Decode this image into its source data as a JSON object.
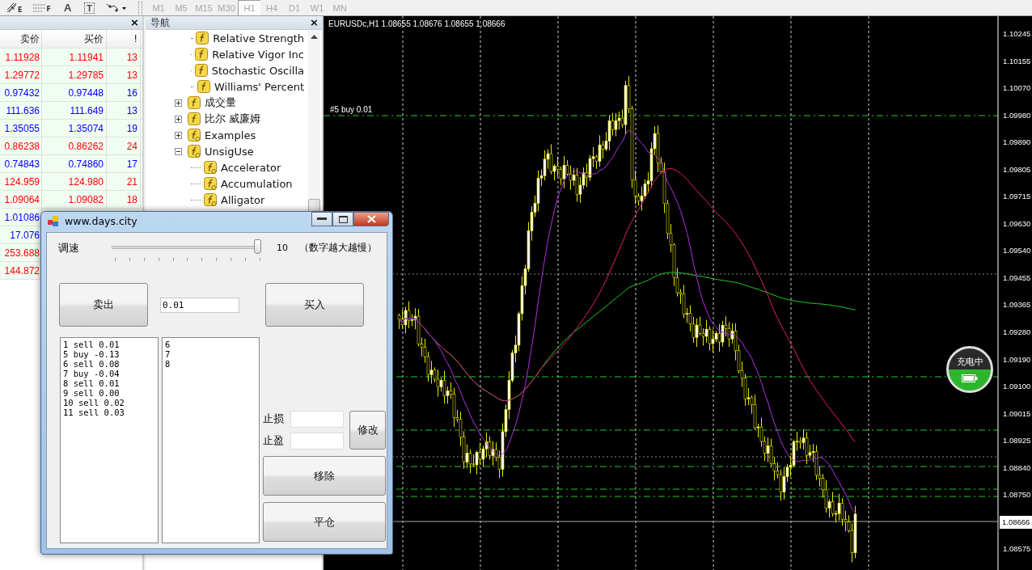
{
  "toolbar": {
    "tools": [
      {
        "kind": "grid",
        "label": "E"
      },
      {
        "kind": "lines",
        "label": "F"
      },
      {
        "kind": "text",
        "label": "A"
      },
      {
        "kind": "textbox",
        "label": "T"
      },
      {
        "kind": "arrows"
      }
    ],
    "timeframes": [
      {
        "label": "M1",
        "selected": false
      },
      {
        "label": "M5",
        "selected": false
      },
      {
        "label": "M15",
        "selected": false
      },
      {
        "label": "M30",
        "selected": false
      },
      {
        "label": "H1",
        "selected": true
      },
      {
        "label": "H4",
        "selected": false
      },
      {
        "label": "D1",
        "selected": false
      },
      {
        "label": "W1",
        "selected": false
      },
      {
        "label": "MN",
        "selected": false
      }
    ]
  },
  "market_watch": {
    "close": "×",
    "columns": [
      "卖价",
      "买价",
      "!"
    ],
    "rows": [
      {
        "bid": "1.11928",
        "ask": "1.11941",
        "spread": "13",
        "color": "#ff0000"
      },
      {
        "bid": "1.29772",
        "ask": "1.29785",
        "spread": "13",
        "color": "#ff0000"
      },
      {
        "bid": "0.97432",
        "ask": "0.97448",
        "spread": "16",
        "color": "#0000ff"
      },
      {
        "bid": "111.636",
        "ask": "111.649",
        "spread": "13",
        "color": "#0000ff"
      },
      {
        "bid": "1.35055",
        "ask": "1.35074",
        "spread": "19",
        "color": "#0000ff"
      },
      {
        "bid": "0.86238",
        "ask": "0.86262",
        "spread": "24",
        "color": "#ff0000"
      },
      {
        "bid": "0.74843",
        "ask": "0.74860",
        "spread": "17",
        "color": "#0000ff"
      },
      {
        "bid": "124.959",
        "ask": "124.980",
        "spread": "21",
        "color": "#ff0000"
      },
      {
        "bid": "1.09064",
        "ask": "1.09082",
        "spread": "18",
        "color": "#ff0000"
      },
      {
        "bid": "1.01086",
        "color": "#0000ff"
      },
      {
        "bid": "17.076",
        "color": "#0000ff"
      },
      {
        "bid": "253.688",
        "color": "#ff0000"
      },
      {
        "bid": "144.872",
        "color": "#ff0000"
      }
    ]
  },
  "navigator": {
    "title": "导航",
    "close": "×",
    "items": [
      {
        "kind": "continued",
        "children": [
          {
            "label": "Relative Strength",
            "kind": "indicator"
          },
          {
            "label": "Relative Vigor Inc",
            "kind": "indicator"
          },
          {
            "label": "Stochastic Oscilla",
            "kind": "indicator"
          },
          {
            "label": "Williams' Percent",
            "kind": "indicator"
          }
        ]
      },
      {
        "label": "成交量",
        "kind": "indicator",
        "expanded": false
      },
      {
        "label": "比尔 威廉姆",
        "kind": "indicator",
        "expanded": false
      },
      {
        "label": "Examples",
        "kind": "custom",
        "expanded": false
      },
      {
        "label": "UnsigUse",
        "kind": "custom",
        "expanded": true,
        "children": [
          {
            "label": "Accelerator",
            "kind": "custom"
          },
          {
            "label": "Accumulation",
            "kind": "custom"
          },
          {
            "label": "Alligator",
            "kind": "custom"
          }
        ]
      }
    ]
  },
  "chart": {
    "header": "EURUSDc,H1  1.08655 1.08676 1.08655 1.08666",
    "order_label": "#5 buy 0.01",
    "price_labels": [
      {
        "label": "1.10245",
        "current": false
      },
      {
        "label": "1.10155",
        "current": false
      },
      {
        "label": "1.10070",
        "current": false
      },
      {
        "label": "1.09980",
        "current": false
      },
      {
        "label": "1.09890",
        "current": false
      },
      {
        "label": "1.09805",
        "current": false
      },
      {
        "label": "1.09715",
        "current": false
      },
      {
        "label": "1.09630",
        "current": false
      },
      {
        "label": "1.09540",
        "current": false
      },
      {
        "label": "1.09455",
        "current": false
      },
      {
        "label": "1.09365",
        "current": false
      },
      {
        "label": "1.09280",
        "current": false
      },
      {
        "label": "1.09190",
        "current": false
      },
      {
        "label": "1.09100",
        "current": false
      },
      {
        "label": "1.09015",
        "current": false
      },
      {
        "label": "1.08925",
        "current": false
      },
      {
        "label": "1.08840",
        "current": false
      },
      {
        "label": "1.08750",
        "current": false
      },
      {
        "label": "1.08666",
        "current": true
      },
      {
        "label": "1.08575",
        "current": false
      }
    ]
  },
  "charging": {
    "label": "充电中"
  },
  "dialog": {
    "title": "www.days.city",
    "speed_label": "调速",
    "speed": {
      "level": 1
    },
    "speed_value": "10",
    "speed_hint": "（数字越大越慢）",
    "sell": "卖出",
    "lots": "0.01",
    "buy": "买入",
    "orders": [
      "1 sell 0.01",
      "5 buy -0.13",
      "6 sell 0.08",
      "7 buy -0.04",
      "8 sell 0.01",
      "9 sell 0.00",
      "10 sell 0.02",
      "11 sell 0.03"
    ],
    "selected_orders": [
      "6",
      "7",
      "8"
    ],
    "stop_loss": "止损",
    "take_profit": "止盈",
    "modify": "修改",
    "remove": "移除",
    "close_all": "平仓"
  }
}
